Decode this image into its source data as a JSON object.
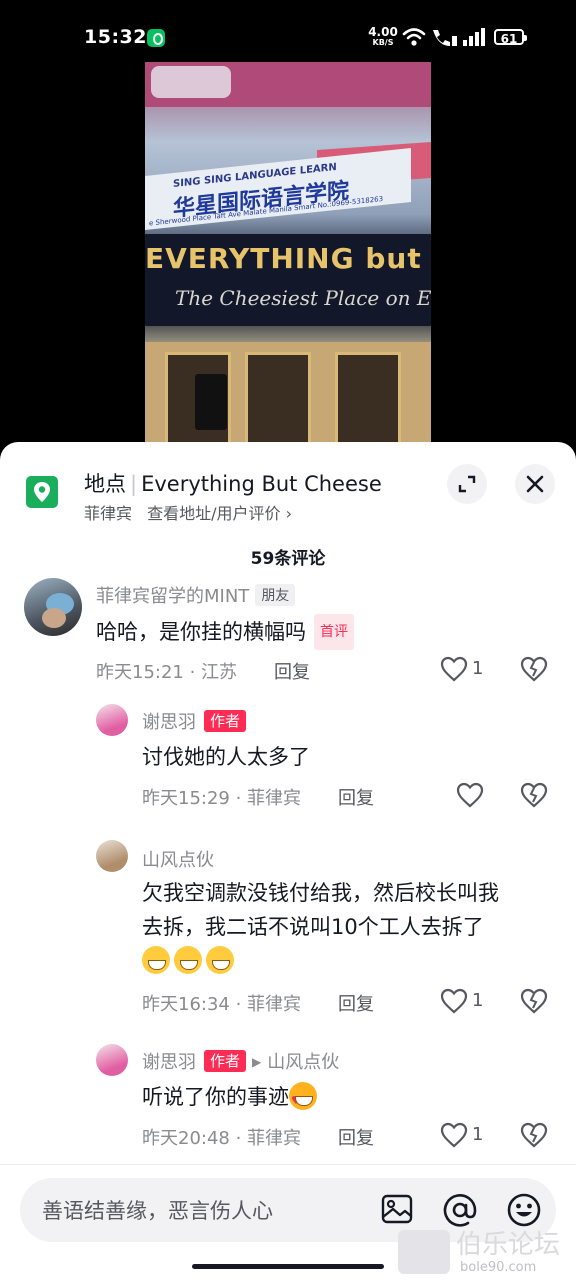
{
  "status_bar": {
    "time": "15:32",
    "net_speed": "4.00",
    "net_unit": "KB/S",
    "battery": "61"
  },
  "video": {
    "sign_en": "SING SING LANGUAGE LEARN",
    "sign_cn": "华星国际语言学院",
    "sign_addr": "e Sherwood Place Taft Ave Malate Manila  Smart No.:0969-5318263",
    "store_line1": "EVERYTHING but C",
    "store_line2": "The Cheesiest Place on E"
  },
  "location": {
    "label": "地点",
    "name": "Everything But Cheese",
    "country": "菲律宾",
    "link": "查看地址/用户评价 ›"
  },
  "comment_count": "59条评论",
  "comments": [
    {
      "user": "菲律宾留学的MINT",
      "tag": "朋友",
      "text": "哈哈，是你挂的横幅吗",
      "badge": "首评",
      "meta": "昨天15:21 · 江苏",
      "reply": "回复",
      "likes": "1"
    },
    {
      "user": "谢思羽",
      "tag": "作者",
      "text": "讨伐她的人太多了",
      "meta": "昨天15:29 · 菲律宾",
      "reply": "回复"
    },
    {
      "user": "山风点伙",
      "text_line1": "欠我空调款没钱付给我，然后校长叫我",
      "text_line2": "去拆，我二话不说叫10个工人去拆了",
      "meta": "昨天16:34 · 菲律宾",
      "reply": "回复",
      "likes": "1"
    },
    {
      "user": "谢思羽",
      "tag": "作者",
      "reply_to": "山风点伙",
      "text": "听说了你的事迹",
      "meta": "昨天20:48 · 菲律宾",
      "reply": "回复",
      "likes": "1"
    }
  ],
  "input": {
    "placeholder": "善语结善缘，恶言伤人心"
  },
  "watermark": {
    "cn": "伯乐论坛",
    "url": "bole90.com"
  },
  "colors": {
    "accent": "#fe2c55",
    "location_green": "#1aad5c"
  },
  "icons": [
    "location-pin-icon",
    "expand-icon",
    "close-icon",
    "heart-icon",
    "broken-heart-icon",
    "image-icon",
    "at-icon",
    "emoji-icon"
  ]
}
